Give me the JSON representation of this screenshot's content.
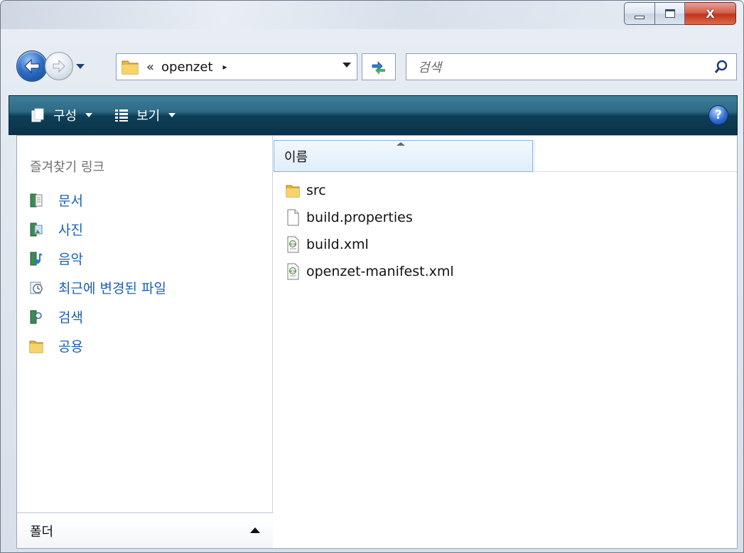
{
  "window": {
    "close_glyph": "X"
  },
  "address": {
    "crumb_chevron": "«",
    "path": "openzet",
    "crumb_arrow": "▸"
  },
  "search": {
    "placeholder": "검색"
  },
  "toolbar": {
    "organize_label": "구성",
    "views_label": "보기",
    "help_label": "?"
  },
  "nav_pane": {
    "title": "즐겨찾기 링크",
    "items": [
      {
        "label": "문서",
        "icon": "documents-icon"
      },
      {
        "label": "사진",
        "icon": "pictures-icon"
      },
      {
        "label": "음악",
        "icon": "music-icon"
      },
      {
        "label": "최근에 변경된 파일",
        "icon": "recent-files-icon"
      },
      {
        "label": "검색",
        "icon": "searches-icon"
      },
      {
        "label": "공용",
        "icon": "public-folder-icon"
      }
    ],
    "folders_label": "폴더"
  },
  "file_list": {
    "column_name": "이름",
    "items": [
      {
        "name": "src",
        "type": "folder"
      },
      {
        "name": "build.properties",
        "type": "file"
      },
      {
        "name": "build.xml",
        "type": "xml"
      },
      {
        "name": "openzet-manifest.xml",
        "type": "xml"
      }
    ]
  },
  "colors": {
    "command_bar": "#0e3f58",
    "link_text": "#1b5fb6",
    "close_button": "#c2331a"
  }
}
